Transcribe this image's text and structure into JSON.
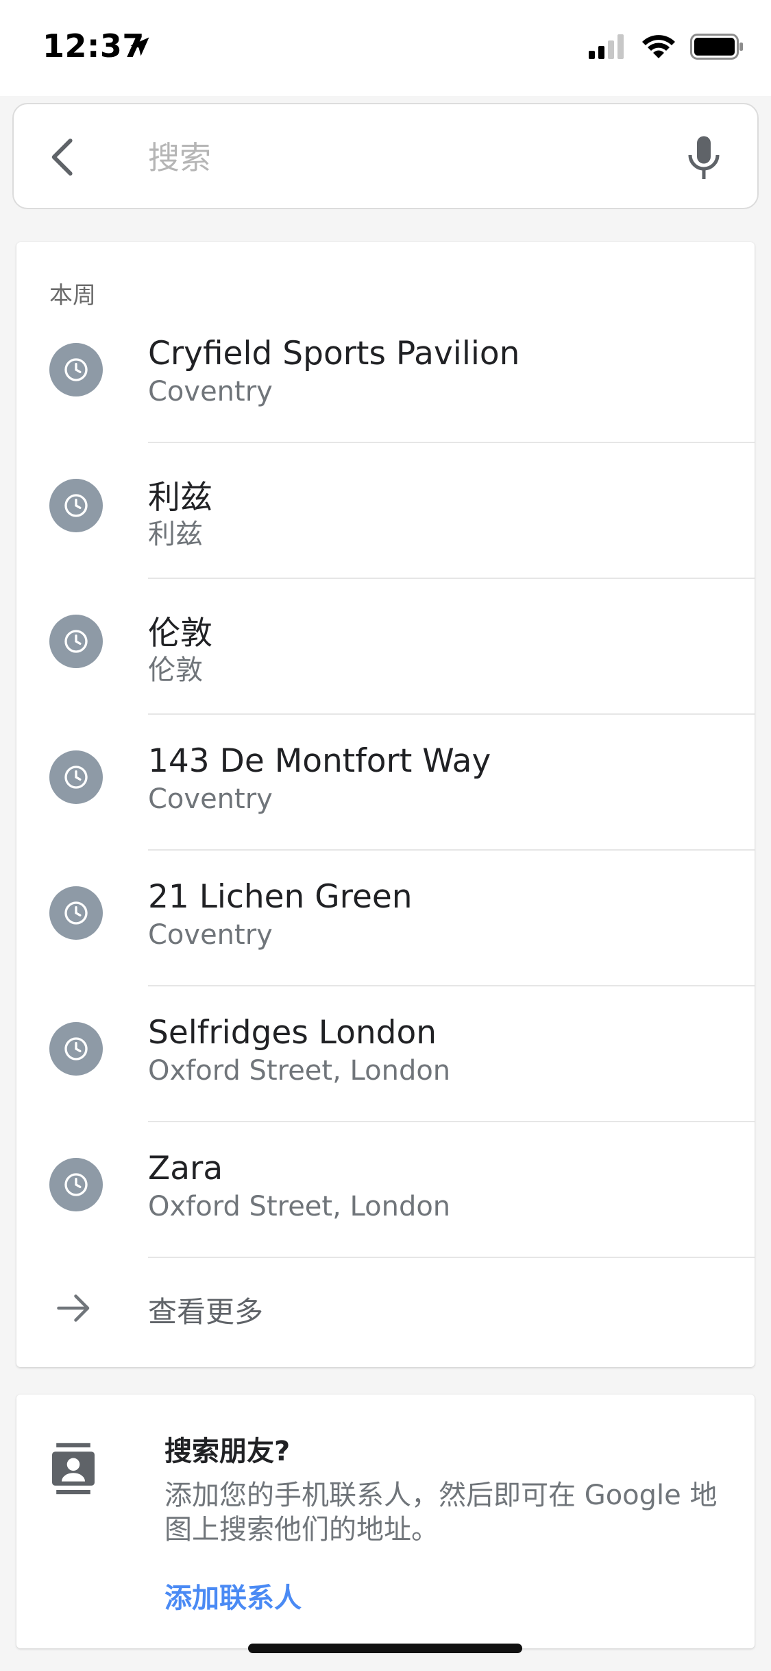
{
  "status_bar": {
    "time": "12:37",
    "icons": [
      "location-arrow-icon",
      "signal-icon",
      "wifi-icon",
      "battery-icon"
    ]
  },
  "search": {
    "placeholder": "搜索",
    "value": ""
  },
  "recent": {
    "section_title": "本周",
    "items": [
      {
        "title": "Cryfield Sports Pavilion",
        "subtitle": "Coventry"
      },
      {
        "title": "利兹",
        "subtitle": "利兹"
      },
      {
        "title": "伦敦",
        "subtitle": "伦敦"
      },
      {
        "title": "143 De Montfort Way",
        "subtitle": "Coventry"
      },
      {
        "title": "21 Lichen Green",
        "subtitle": "Coventry"
      },
      {
        "title": "Selfridges London",
        "subtitle": "Oxford Street, London"
      },
      {
        "title": "Zara",
        "subtitle": "Oxford Street, London"
      }
    ],
    "see_more_label": "查看更多"
  },
  "friends": {
    "title": "搜索朋友?",
    "description": "添加您的手机联系人，然后即可在 Google 地图上搜索他们的地址。",
    "action_label": "添加联系人"
  },
  "colors": {
    "accent": "#4a8af4",
    "clock_badge": "#8e9aa6"
  }
}
